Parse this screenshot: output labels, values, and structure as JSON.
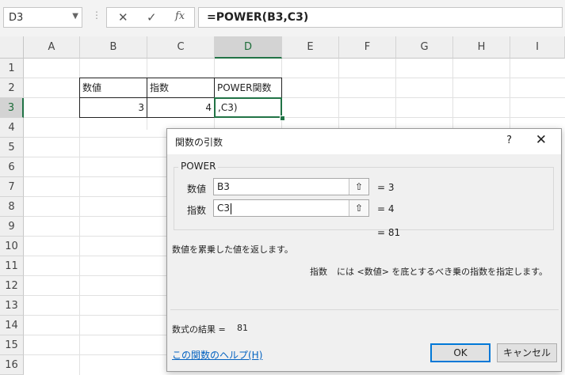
{
  "formula_bar": {
    "name_box": "D3",
    "formula": "=POWER(B3,C3)",
    "cancel_icon": "✕",
    "enter_icon": "✓",
    "fx_icon": "fx"
  },
  "columns": [
    "A",
    "B",
    "C",
    "D",
    "E",
    "F",
    "G",
    "H",
    "I"
  ],
  "rows": [
    "1",
    "2",
    "3",
    "4",
    "5",
    "6",
    "7",
    "8",
    "9",
    "10",
    "11",
    "12",
    "13",
    "14",
    "15",
    "16"
  ],
  "cells": {
    "B2": "数値",
    "C2": "指数",
    "D2": "POWER関数",
    "B3": "3",
    "C3": "4",
    "D3": ",C3)"
  },
  "dialog": {
    "title": "関数の引数",
    "help_button": "?",
    "close_button": "✕",
    "function_name": "POWER",
    "args": [
      {
        "label": "数値",
        "value": "B3",
        "result": "=  3"
      },
      {
        "label": "指数",
        "value": "C3",
        "result": "=  4"
      }
    ],
    "ref_icon": "⇧",
    "function_result": "=  81",
    "description": "数値を累乗した値を返します。",
    "arg_description_name": "指数",
    "arg_description": "には <数値> を底とするべき乗の指数を指定します。",
    "formula_result_label": "数式の結果 =",
    "formula_result_value": "81",
    "help_link": "この関数のヘルプ(H)",
    "ok": "OK",
    "cancel": "キャンセル"
  },
  "colors": {
    "accent": "#217346",
    "link": "#0563c1",
    "button_focus": "#0078d7"
  }
}
